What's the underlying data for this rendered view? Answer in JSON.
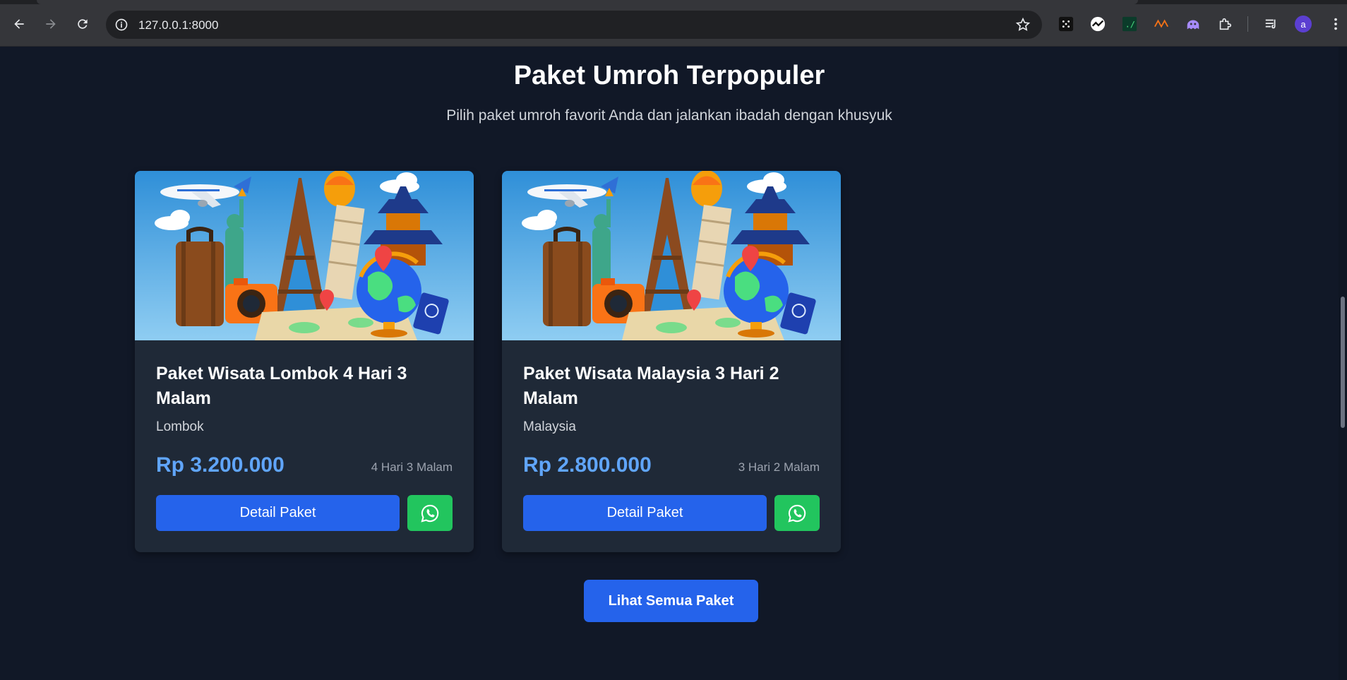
{
  "browser": {
    "url": "127.0.0.1:8000",
    "avatar_letter": "a",
    "nav_icons": [
      "back-arrow-icon",
      "forward-arrow-icon",
      "reload-icon"
    ],
    "extension_icons": [
      "dots-extension-icon",
      "chart-extension-icon",
      "terminal-extension-icon",
      "wave-extension-icon",
      "ghost-extension-icon",
      "puzzle-extension-icon",
      "reading-list-icon"
    ]
  },
  "section": {
    "title": "Paket Umroh Terpopuler",
    "subtitle": "Pilih paket umroh favorit Anda dan jalankan ibadah dengan khusyuk"
  },
  "packages": [
    {
      "title": "Paket Wisata Lombok 4 Hari 3 Malam",
      "location": "Lombok",
      "price": "Rp 3.200.000",
      "duration": "4 Hari 3 Malam",
      "detail_label": "Detail Paket"
    },
    {
      "title": "Paket Wisata Malaysia 3 Hari 2 Malam",
      "location": "Malaysia",
      "price": "Rp 2.800.000",
      "duration": "3 Hari 2 Malam",
      "detail_label": "Detail Paket"
    }
  ],
  "view_all_label": "Lihat Semua Paket",
  "colors": {
    "page_bg": "#111827",
    "card_bg": "#1f2937",
    "primary": "#2563eb",
    "price": "#60a5fa",
    "whatsapp": "#22c55e"
  }
}
